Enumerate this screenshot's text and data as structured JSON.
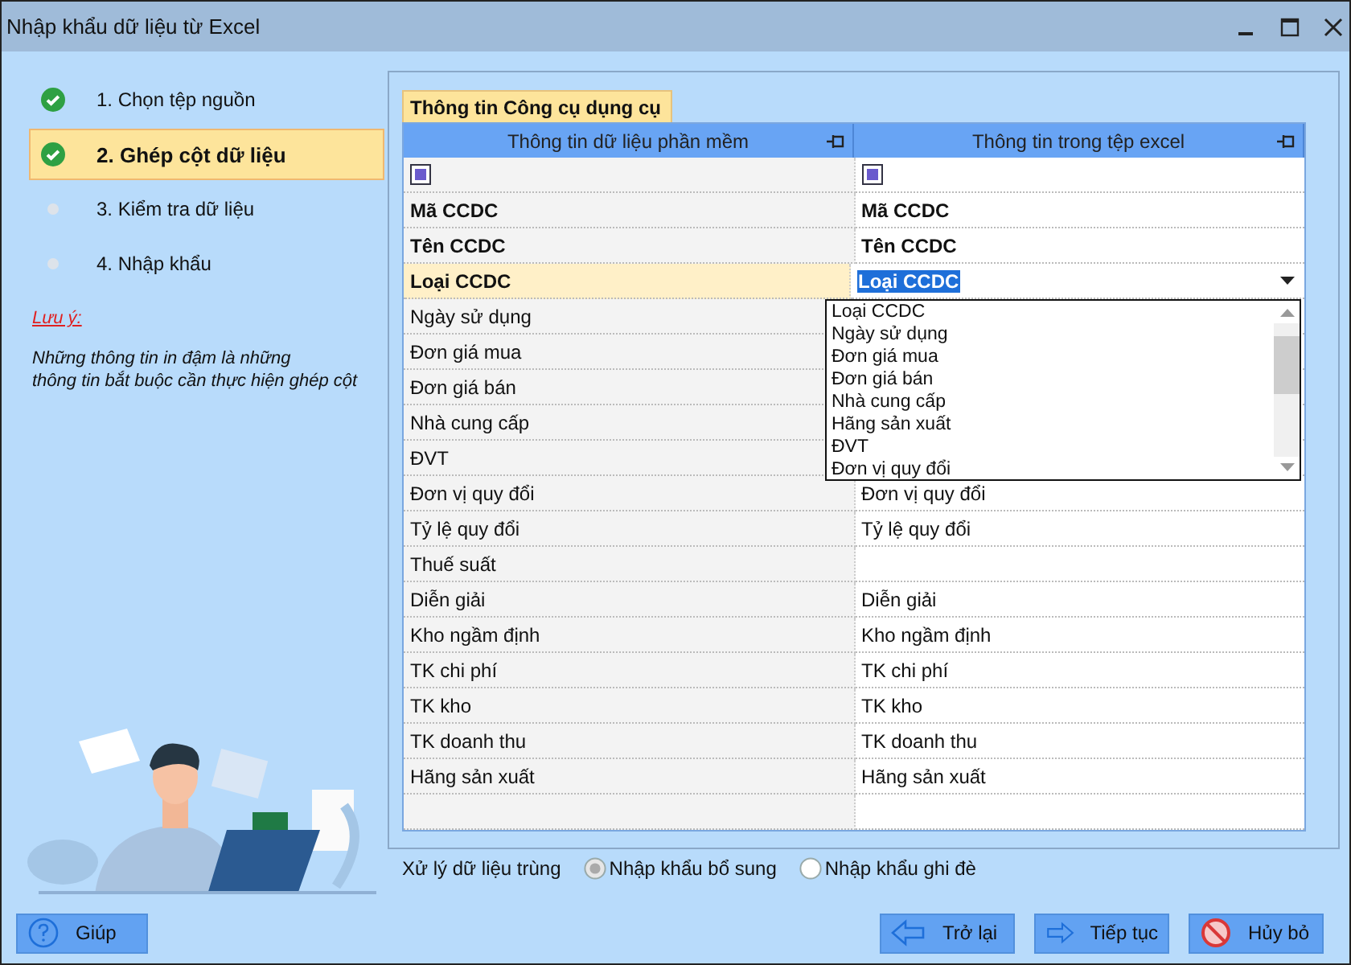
{
  "window": {
    "title": "Nhập khẩu dữ liệu từ Excel"
  },
  "steps": [
    {
      "label": "1. Chọn tệp nguồn",
      "done": true,
      "selected": false
    },
    {
      "label": "2. Ghép cột dữ liệu",
      "done": true,
      "selected": true
    },
    {
      "label": "3. Kiểm tra dữ liệu",
      "done": false,
      "selected": false
    },
    {
      "label": "4. Nhập khẩu",
      "done": false,
      "selected": false
    }
  ],
  "note": {
    "title": "Lưu ý:",
    "text": "Những thông tin in đậm là những\nthông tin bắt buộc cần thực hiện ghép cột"
  },
  "tab": {
    "label": "Thông tin Công cụ dụng cụ"
  },
  "table": {
    "columns": [
      "Thông tin dữ liệu phần mềm",
      "Thông tin trong tệp excel"
    ],
    "check_row": {
      "left_checked": true,
      "right_checked": true
    },
    "rows": [
      {
        "left": "Mã CCDC",
        "right": "Mã CCDC",
        "bold": true,
        "selected": false,
        "editing": false
      },
      {
        "left": "Tên CCDC",
        "right": "Tên CCDC",
        "bold": true,
        "selected": false,
        "editing": false
      },
      {
        "left": "Loại CCDC",
        "right": "Loại CCDC",
        "bold": true,
        "selected": true,
        "editing": true
      },
      {
        "left": "Ngày sử dụng",
        "bold": false,
        "selected": false,
        "editing": false
      },
      {
        "left": "Đơn giá mua",
        "bold": false,
        "selected": false,
        "editing": false
      },
      {
        "left": "Đơn giá bán",
        "bold": false,
        "selected": false,
        "editing": false
      },
      {
        "left": "Nhà cung cấp",
        "bold": false,
        "selected": false,
        "editing": false
      },
      {
        "left": "ĐVT",
        "bold": false,
        "selected": false,
        "editing": false
      },
      {
        "left": "Đơn vị quy đổi",
        "right": "Đơn vị quy đổi",
        "bold": false,
        "selected": false,
        "editing": false
      },
      {
        "left": "Tỷ lệ quy đổi",
        "right": "Tỷ lệ quy đổi",
        "bold": false,
        "selected": false,
        "editing": false
      },
      {
        "left": "Thuế suất",
        "bold": false,
        "selected": false,
        "editing": false
      },
      {
        "left": "Diễn giải",
        "right": "Diễn giải",
        "bold": false,
        "selected": false,
        "editing": false
      },
      {
        "left": "Kho ngầm định",
        "right": "Kho ngầm định",
        "bold": false,
        "selected": false,
        "editing": false
      },
      {
        "left": "TK chi phí",
        "right": "TK chi phí",
        "bold": false,
        "selected": false,
        "editing": false
      },
      {
        "left": "TK kho",
        "right": "TK kho",
        "bold": false,
        "selected": false,
        "editing": false
      },
      {
        "left": "TK doanh thu",
        "right": "TK doanh thu",
        "bold": false,
        "selected": false,
        "editing": false
      },
      {
        "left": "Hãng sản xuất",
        "right": "Hãng sản xuất",
        "bold": false,
        "selected": false,
        "editing": false
      }
    ],
    "dropdown": [
      "Loại CCDC",
      "Ngày sử dụng",
      "Đơn giá mua",
      "Đơn giá bán",
      "Nhà cung cấp",
      "Hãng sản xuất",
      "ĐVT",
      "Đơn vị quy đổi"
    ]
  },
  "duplicates": {
    "label": "Xử lý dữ liệu trùng",
    "options": [
      {
        "label": "Nhập khẩu bổ sung",
        "selected": true,
        "disabled": true
      },
      {
        "label": "Nhập khẩu ghi đè",
        "selected": false,
        "disabled": false
      }
    ]
  },
  "buttons": {
    "help": "Giúp",
    "back": "Trở lại",
    "next": "Tiếp tục",
    "cancel": "Hủy bỏ"
  }
}
